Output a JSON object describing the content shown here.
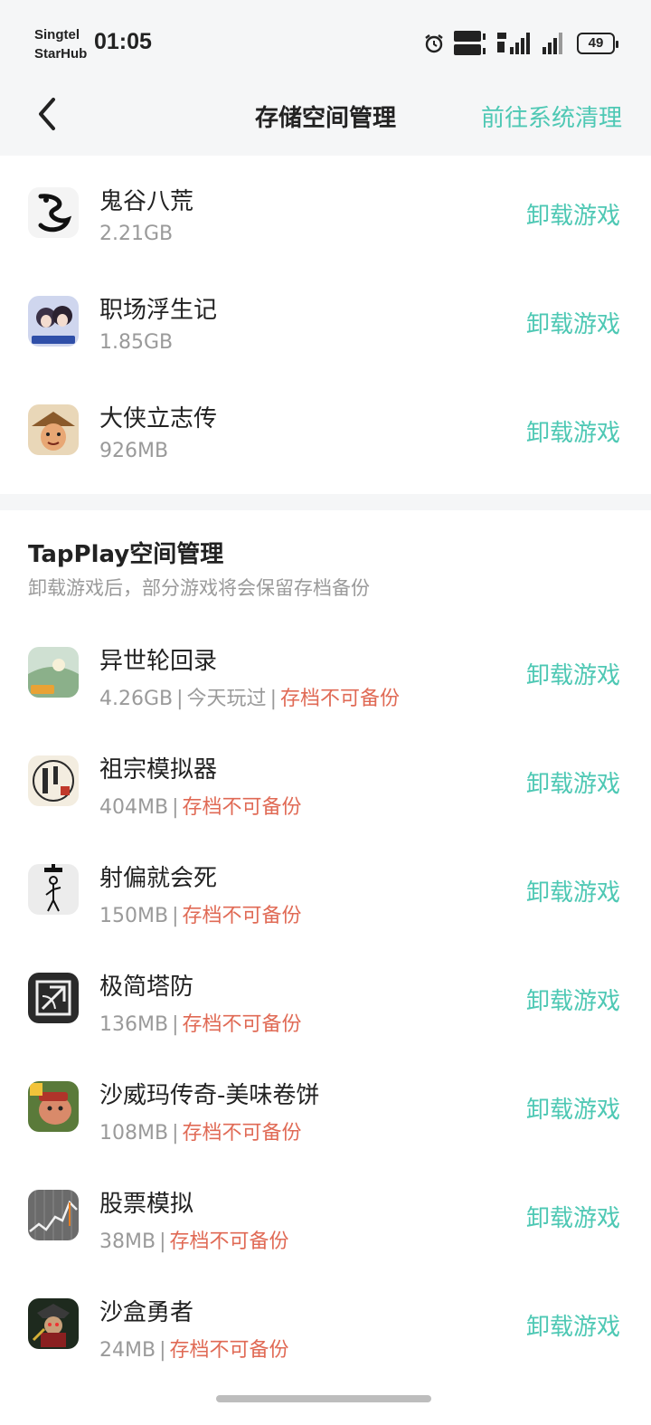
{
  "status_bar": {
    "carrier_line1": "Singtel",
    "carrier_line2": "StarHub",
    "time": "01:05",
    "battery": "49",
    "icons": [
      "alarm-icon",
      "volte-hd-icon",
      "5g-signal-icon",
      "signal-icon",
      "battery-icon"
    ]
  },
  "header": {
    "title": "存储空间管理",
    "action": "前往系统清理",
    "back_icon": "chevron-left-icon"
  },
  "colors": {
    "accent": "#4ec8b4",
    "warning": "#e06a55",
    "muted": "#9a9a9a"
  },
  "device_games": [
    {
      "name": "鬼谷八荒",
      "size": "2.21GB",
      "action": "卸载游戏"
    },
    {
      "name": "职场浮生记",
      "size": "1.85GB",
      "action": "卸载游戏"
    },
    {
      "name": "大侠立志传",
      "size": "926MB",
      "action": "卸载游戏"
    }
  ],
  "tapplay": {
    "title": "TapPlay空间管理",
    "subtitle": "卸载游戏后，部分游戏将会保留存档备份",
    "games": [
      {
        "name": "异世轮回录",
        "size": "4.26GB",
        "played": "今天玩过",
        "backup": "存档不可备份",
        "action": "卸载游戏"
      },
      {
        "name": "祖宗模拟器",
        "size": "404MB",
        "backup": "存档不可备份",
        "action": "卸载游戏"
      },
      {
        "name": "射偏就会死",
        "size": "150MB",
        "backup": "存档不可备份",
        "action": "卸载游戏"
      },
      {
        "name": "极简塔防",
        "size": "136MB",
        "backup": "存档不可备份",
        "action": "卸载游戏"
      },
      {
        "name": "沙威玛传奇-美味卷饼",
        "size": "108MB",
        "backup": "存档不可备份",
        "action": "卸载游戏"
      },
      {
        "name": "股票模拟",
        "size": "38MB",
        "backup": "存档不可备份",
        "action": "卸载游戏"
      },
      {
        "name": "沙盒勇者",
        "size": "24MB",
        "backup": "存档不可备份",
        "action": "卸载游戏"
      }
    ]
  },
  "separator": "|"
}
